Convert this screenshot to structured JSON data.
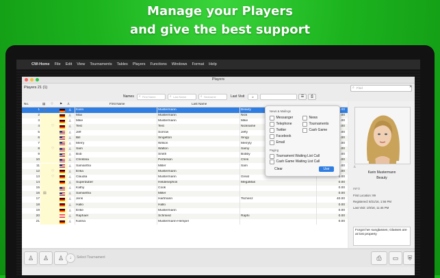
{
  "headline": {
    "line1": "Manage your Players",
    "line2": "and give the best support"
  },
  "menubar": [
    "CW-Home",
    "File",
    "Edit",
    "View",
    "Tournaments",
    "Tables",
    "Players",
    "Functions",
    "Windows",
    "Format",
    "Help"
  ],
  "window": {
    "title": "Players",
    "players_count": "Players  21 (1)",
    "find_placeholder": "Find"
  },
  "filters": {
    "names_label": "Names",
    "first_name_ph": "First Name",
    "last_name_ph": "Last Name",
    "nickname_ph": "Nickname",
    "last_visit_label": "Last Visit",
    "last_visit_op": "≥"
  },
  "table": {
    "headers": {
      "no": "No.",
      "first": "First Name",
      "last": "Last Name"
    },
    "rows": [
      {
        "no": "1",
        "first": "Karin",
        "last": "Mustermann",
        "nick": "Beauty",
        "num": "0.00",
        "flag": "de",
        "selected": true,
        "i1": "▤",
        "i2": "♡"
      },
      {
        "no": "2",
        "first": "Max",
        "last": "Mustermann",
        "nick": "Nick",
        "num": "0.00",
        "flag": "de"
      },
      {
        "no": "3",
        "first": "Mike",
        "last": "Mustermann",
        "nick": "Mike",
        "num": "0.00",
        "flag": "de"
      },
      {
        "no": "4",
        "first": "Test",
        "last": "Test",
        "nick": "Nickname",
        "num": "0.00",
        "flag": "de",
        "i2": "♡"
      },
      {
        "no": "5",
        "first": "Jeff",
        "last": "Sorrow",
        "nick": "Jeffy",
        "num": "0.00",
        "flag": "us"
      },
      {
        "no": "6",
        "first": "Bill",
        "last": "Singelton",
        "nick": "Singy",
        "num": "0.00",
        "flag": "us"
      },
      {
        "no": "7",
        "first": "Merry",
        "last": "Wilson",
        "nick": "Merryly",
        "num": "0.00",
        "flag": "us"
      },
      {
        "no": "8",
        "first": "Sam",
        "last": "Walton",
        "nick": "Samy",
        "num": "0.00",
        "flag": "us",
        "i2": "♡"
      },
      {
        "no": "9",
        "first": "Bob",
        "last": "Smith",
        "nick": "Bobby",
        "num": "0.00",
        "flag": "us"
      },
      {
        "no": "10",
        "first": "Christina",
        "last": "Perterson",
        "nick": "Chris",
        "num": "0.00",
        "flag": "us"
      },
      {
        "no": "11",
        "first": "Samantha",
        "last": "Miller",
        "nick": "Sam",
        "num": "0.00",
        "flag": "us"
      },
      {
        "no": "12",
        "first": "Erika",
        "last": "Mustermann",
        "nick": "",
        "num": "0.00",
        "flag": "de",
        "i2": "♡"
      },
      {
        "no": "13",
        "first": "Claudia",
        "last": "Mustermann",
        "nick": "Great",
        "num": "0.00",
        "flag": "de",
        "i2": "♡"
      },
      {
        "no": "14",
        "first": "Superduber",
        "last": "Heldenephos",
        "nick": "MegaMan",
        "num": "0.00",
        "flag": "de"
      },
      {
        "no": "15",
        "first": "Kathy",
        "last": "Cook",
        "nick": "",
        "num": "0.00",
        "flag": "us"
      },
      {
        "no": "16",
        "first": "Samantha",
        "last": "Miller",
        "nick": "",
        "num": "0.00",
        "flag": "us",
        "i1": "▤"
      },
      {
        "no": "17",
        "first": "Jens",
        "last": "Hartmann",
        "nick": "Tschenz",
        "num": "40.00",
        "flag": "de"
      },
      {
        "no": "18",
        "first": "Hallo",
        "last": "Hallo",
        "nick": "",
        "num": "0.00",
        "flag": "de"
      },
      {
        "no": "19",
        "first": "Erike",
        "last": "Mustermann",
        "nick": "",
        "num": "0.00",
        "flag": "de"
      },
      {
        "no": "20",
        "first": "Raphael",
        "last": "Schmied",
        "nick": "Raphi",
        "num": "0.00",
        "flag": "at"
      },
      {
        "no": "21",
        "first": "Karina",
        "last": "Mustermann-Hempel",
        "nick": "",
        "num": "0.00",
        "flag": "de"
      }
    ]
  },
  "popover": {
    "news_section": "News & Mailings",
    "news_items": [
      "Messanger",
      "News",
      "Telephone",
      "Tournaments",
      "Twitter",
      "Cash Game",
      "Facebook",
      "Email"
    ],
    "paging_section": "Paging",
    "paging_items": [
      "Tournament Waiting List Call",
      "Cash Game Waiting List Call"
    ],
    "clear": "Clear",
    "use": "Use"
  },
  "detail": {
    "name": "Karin Mustermann",
    "nickname": "Beauty",
    "info_header": "INFO",
    "first_location": "First Location: 99",
    "registered": "Registered: 8/21/16, 1:56 PM",
    "last_visit": "Last Visit: 1/9/18, 11:45 PM",
    "note": "Forgot her sunglasses; Glasses are at lost property"
  },
  "bottombar": {
    "select_tournament": "Select Tournament"
  },
  "colors": {
    "accent": "#2f7de1",
    "green_bg": "#18b81a"
  }
}
